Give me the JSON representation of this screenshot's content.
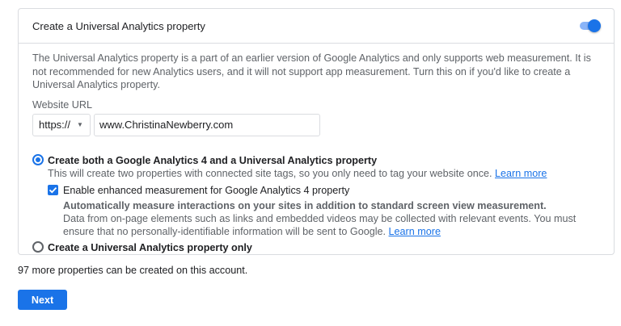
{
  "card": {
    "title": "Create a Universal Analytics property",
    "toggle_on": true,
    "description": "The Universal Analytics property is a part of an earlier version of Google Analytics and only supports web measurement. It is not recommended for new Analytics users, and it will not support app measurement. Turn this on if you'd like to create a Universal Analytics property.",
    "url_label": "Website URL",
    "protocol_value": "https://",
    "url_value": "www.ChristinaNewberry.com"
  },
  "option_both": {
    "selected": true,
    "title": "Create both a Google Analytics 4 and a Universal Analytics property",
    "subtitle": "This will create two properties with connected site tags, so you only need to tag your website once.",
    "learn_more": "Learn more",
    "enhanced": {
      "checked": true,
      "label": "Enable enhanced measurement for Google Analytics 4 property",
      "bold_text": "Automatically measure interactions on your sites in addition to standard screen view measurement.",
      "description": "Data from on-page elements such as links and embedded videos may be collected with relevant events. You must ensure that no personally-identifiable information will be sent to Google.",
      "learn_more": "Learn more"
    }
  },
  "option_ua_only": {
    "selected": false,
    "title": "Create a Universal Analytics property only"
  },
  "footer": {
    "more_text": "97 more properties can be created on this account.",
    "next_label": "Next"
  },
  "colors": {
    "accent": "#1a73e8",
    "border": "#dadce0",
    "secondary_text": "#5f6368"
  }
}
